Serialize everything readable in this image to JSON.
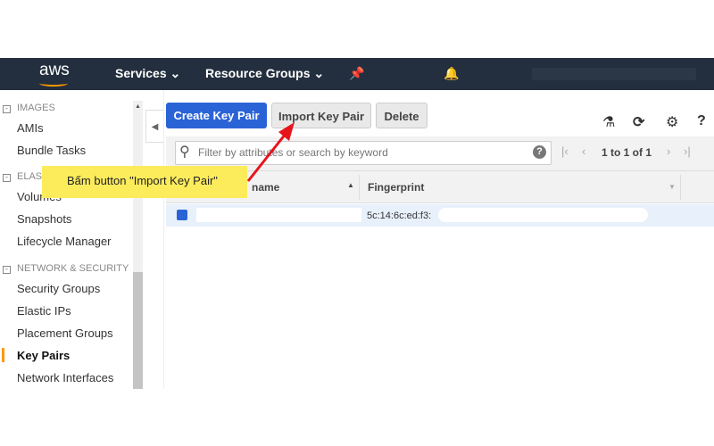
{
  "nav": {
    "logo": "aws",
    "services": "Services ⌄",
    "resource_groups": "Resource Groups ⌄"
  },
  "sidebar": {
    "images_header": "IMAGES",
    "amis": "AMIs",
    "bundle_tasks": "Bundle Tasks",
    "elastic_header": "ELAS",
    "volumes": "Volumes",
    "snapshots": "Snapshots",
    "lifecycle": "Lifecycle Manager",
    "network_header": "NETWORK & SECURITY",
    "security_groups": "Security Groups",
    "elastic_ips": "Elastic IPs",
    "placement_groups": "Placement Groups",
    "key_pairs": "Key Pairs",
    "network_interfaces": "Network Interfaces"
  },
  "toolbar": {
    "create": "Create Key Pair",
    "import": "Import Key Pair",
    "delete": "Delete"
  },
  "filter": {
    "placeholder": "Filter by attributes or search by keyword",
    "pagination": "1 to 1 of 1"
  },
  "table": {
    "col_name": "name",
    "col_fingerprint": "Fingerprint",
    "rows": [
      {
        "fingerprint": "5c:14:6c:ed:f3:"
      }
    ]
  },
  "annotation": "Bấm button \"Import Key Pair\"",
  "colors": {
    "accent": "#2a63d6",
    "nav": "#232f3e",
    "annotation": "#fcec5c",
    "arrow": "#e8141c"
  }
}
